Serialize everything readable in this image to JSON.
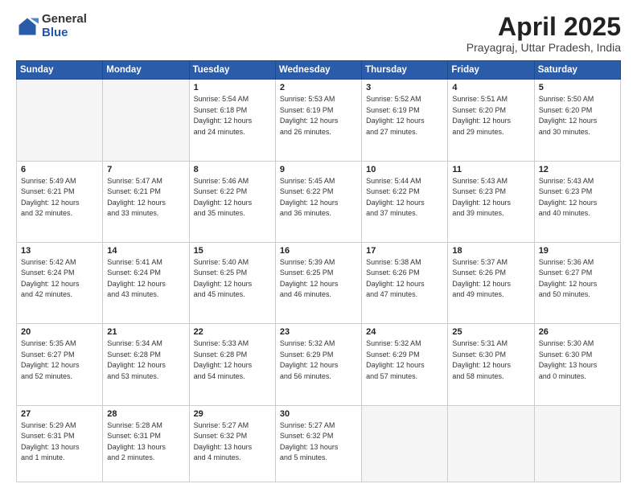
{
  "logo": {
    "general": "General",
    "blue": "Blue"
  },
  "header": {
    "title": "April 2025",
    "location": "Prayagraj, Uttar Pradesh, India"
  },
  "weekdays": [
    "Sunday",
    "Monday",
    "Tuesday",
    "Wednesday",
    "Thursday",
    "Friday",
    "Saturday"
  ],
  "weeks": [
    [
      {
        "num": "",
        "empty": true
      },
      {
        "num": "",
        "empty": true
      },
      {
        "num": "1",
        "info": "Sunrise: 5:54 AM\nSunset: 6:18 PM\nDaylight: 12 hours\nand 24 minutes."
      },
      {
        "num": "2",
        "info": "Sunrise: 5:53 AM\nSunset: 6:19 PM\nDaylight: 12 hours\nand 26 minutes."
      },
      {
        "num": "3",
        "info": "Sunrise: 5:52 AM\nSunset: 6:19 PM\nDaylight: 12 hours\nand 27 minutes."
      },
      {
        "num": "4",
        "info": "Sunrise: 5:51 AM\nSunset: 6:20 PM\nDaylight: 12 hours\nand 29 minutes."
      },
      {
        "num": "5",
        "info": "Sunrise: 5:50 AM\nSunset: 6:20 PM\nDaylight: 12 hours\nand 30 minutes."
      }
    ],
    [
      {
        "num": "6",
        "info": "Sunrise: 5:49 AM\nSunset: 6:21 PM\nDaylight: 12 hours\nand 32 minutes."
      },
      {
        "num": "7",
        "info": "Sunrise: 5:47 AM\nSunset: 6:21 PM\nDaylight: 12 hours\nand 33 minutes."
      },
      {
        "num": "8",
        "info": "Sunrise: 5:46 AM\nSunset: 6:22 PM\nDaylight: 12 hours\nand 35 minutes."
      },
      {
        "num": "9",
        "info": "Sunrise: 5:45 AM\nSunset: 6:22 PM\nDaylight: 12 hours\nand 36 minutes."
      },
      {
        "num": "10",
        "info": "Sunrise: 5:44 AM\nSunset: 6:22 PM\nDaylight: 12 hours\nand 37 minutes."
      },
      {
        "num": "11",
        "info": "Sunrise: 5:43 AM\nSunset: 6:23 PM\nDaylight: 12 hours\nand 39 minutes."
      },
      {
        "num": "12",
        "info": "Sunrise: 5:43 AM\nSunset: 6:23 PM\nDaylight: 12 hours\nand 40 minutes."
      }
    ],
    [
      {
        "num": "13",
        "info": "Sunrise: 5:42 AM\nSunset: 6:24 PM\nDaylight: 12 hours\nand 42 minutes."
      },
      {
        "num": "14",
        "info": "Sunrise: 5:41 AM\nSunset: 6:24 PM\nDaylight: 12 hours\nand 43 minutes."
      },
      {
        "num": "15",
        "info": "Sunrise: 5:40 AM\nSunset: 6:25 PM\nDaylight: 12 hours\nand 45 minutes."
      },
      {
        "num": "16",
        "info": "Sunrise: 5:39 AM\nSunset: 6:25 PM\nDaylight: 12 hours\nand 46 minutes."
      },
      {
        "num": "17",
        "info": "Sunrise: 5:38 AM\nSunset: 6:26 PM\nDaylight: 12 hours\nand 47 minutes."
      },
      {
        "num": "18",
        "info": "Sunrise: 5:37 AM\nSunset: 6:26 PM\nDaylight: 12 hours\nand 49 minutes."
      },
      {
        "num": "19",
        "info": "Sunrise: 5:36 AM\nSunset: 6:27 PM\nDaylight: 12 hours\nand 50 minutes."
      }
    ],
    [
      {
        "num": "20",
        "info": "Sunrise: 5:35 AM\nSunset: 6:27 PM\nDaylight: 12 hours\nand 52 minutes."
      },
      {
        "num": "21",
        "info": "Sunrise: 5:34 AM\nSunset: 6:28 PM\nDaylight: 12 hours\nand 53 minutes."
      },
      {
        "num": "22",
        "info": "Sunrise: 5:33 AM\nSunset: 6:28 PM\nDaylight: 12 hours\nand 54 minutes."
      },
      {
        "num": "23",
        "info": "Sunrise: 5:32 AM\nSunset: 6:29 PM\nDaylight: 12 hours\nand 56 minutes."
      },
      {
        "num": "24",
        "info": "Sunrise: 5:32 AM\nSunset: 6:29 PM\nDaylight: 12 hours\nand 57 minutes."
      },
      {
        "num": "25",
        "info": "Sunrise: 5:31 AM\nSunset: 6:30 PM\nDaylight: 12 hours\nand 58 minutes."
      },
      {
        "num": "26",
        "info": "Sunrise: 5:30 AM\nSunset: 6:30 PM\nDaylight: 13 hours\nand 0 minutes."
      }
    ],
    [
      {
        "num": "27",
        "info": "Sunrise: 5:29 AM\nSunset: 6:31 PM\nDaylight: 13 hours\nand 1 minute."
      },
      {
        "num": "28",
        "info": "Sunrise: 5:28 AM\nSunset: 6:31 PM\nDaylight: 13 hours\nand 2 minutes."
      },
      {
        "num": "29",
        "info": "Sunrise: 5:27 AM\nSunset: 6:32 PM\nDaylight: 13 hours\nand 4 minutes."
      },
      {
        "num": "30",
        "info": "Sunrise: 5:27 AM\nSunset: 6:32 PM\nDaylight: 13 hours\nand 5 minutes."
      },
      {
        "num": "",
        "empty": true
      },
      {
        "num": "",
        "empty": true
      },
      {
        "num": "",
        "empty": true
      }
    ]
  ]
}
